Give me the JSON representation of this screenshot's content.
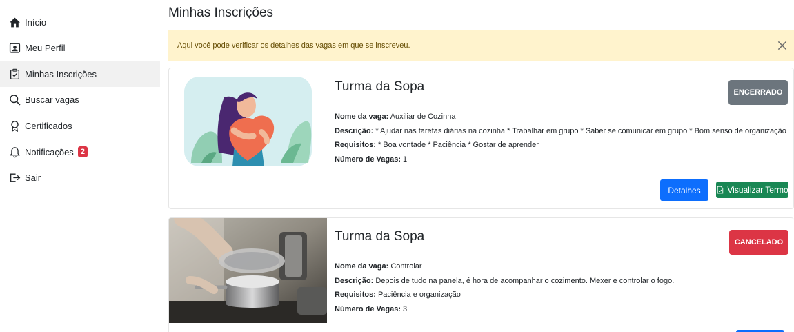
{
  "sidebar": {
    "items": [
      {
        "label": "Início",
        "icon": "house-icon"
      },
      {
        "label": "Meu Perfil",
        "icon": "person-badge-icon"
      },
      {
        "label": "Minhas Inscrições",
        "icon": "clipboard-check-icon"
      },
      {
        "label": "Buscar vagas",
        "icon": "search-icon"
      },
      {
        "label": "Certificados",
        "icon": "award-icon"
      },
      {
        "label": "Notificações",
        "icon": "bell-icon",
        "badge": "2"
      },
      {
        "label": "Sair",
        "icon": "logout-icon"
      }
    ]
  },
  "page": {
    "title": "Minhas Inscrições"
  },
  "alert": {
    "text": "Aqui você pode verificar os detalhes das vagas em que se inscreveu."
  },
  "cards": [
    {
      "title": "Turma da Sopa",
      "status": "ENCERRADO",
      "status_color": "#6c757d",
      "vaga_label": "Nome da vaga:",
      "vaga": "Auxiliar de Cozinha",
      "descricao_label": "Descrição:",
      "descricao": "* Ajudar nas tarefas diárias na cozinha * Trabalhar em grupo * Saber se comunicar em grupo * Bom senso de organização",
      "requisitos_label": "Requisitos:",
      "requisitos": "* Boa vontade * Paciência * Gostar de aprender",
      "numero_label": "Número de Vagas:",
      "numero": "1",
      "details_label": "Detalhes",
      "term_label": "Visualizar Termo"
    },
    {
      "title": "Turma da Sopa",
      "status": "CANCELADO",
      "status_color": "#dc3545",
      "vaga_label": "Nome da vaga:",
      "vaga": "Controlar",
      "descricao_label": "Descrição:",
      "descricao": "Depois de tudo na panela, é hora de acompanhar o cozimento. Mexer e controlar o fogo.",
      "requisitos_label": "Requisitos:",
      "requisitos": "Paciência e organização",
      "numero_label": "Número de Vagas:",
      "numero": "3"
    }
  ]
}
